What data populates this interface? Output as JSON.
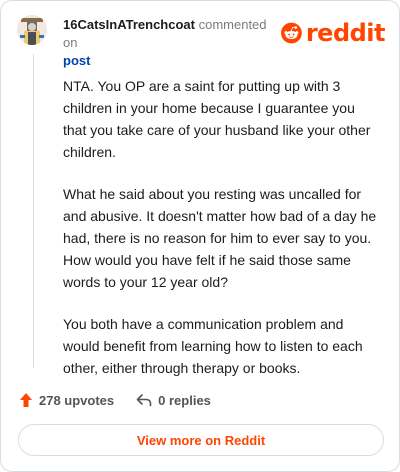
{
  "header": {
    "username": "16CatsInATrenchcoat",
    "commented_on": "commented on",
    "post_link": "post",
    "logo_text": "reddit"
  },
  "avatar_icon": "cat-avatar-icon",
  "colors": {
    "brand": "#ff4500",
    "upvote": "#ff4500",
    "link": "#0045ac",
    "border": "#d8dde1",
    "muted_text": "#7c7c7c"
  },
  "comment": {
    "paragraphs": [
      "NTA. You OP are a saint for putting up with 3 children in your home because I guarantee you that you take care of your husband like your other children.",
      "What he said about you resting was uncalled for and abusive. It doesn't matter how bad of a day he had, there is no reason for him to ever say to you. How would you have felt if he said those same words to your 12 year old?",
      "You both have a communication problem and would benefit from learning how to listen to each other, either through therapy or books."
    ]
  },
  "footer": {
    "upvotes": "278 upvotes",
    "replies": "0 replies",
    "view_more": "View more on Reddit"
  }
}
